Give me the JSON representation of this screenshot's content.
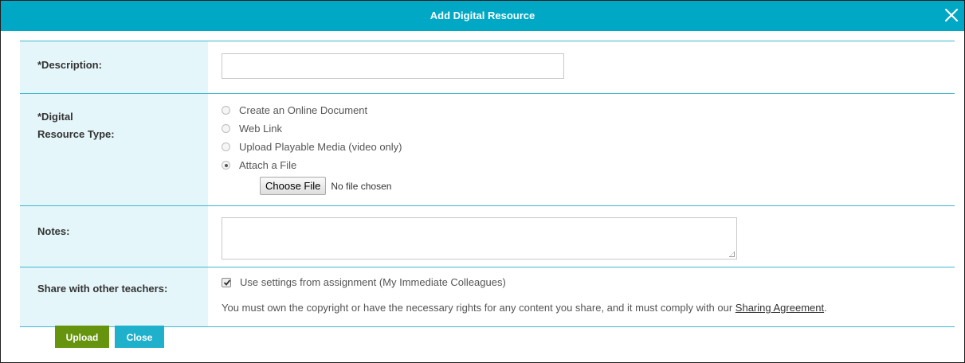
{
  "dialog": {
    "title": "Add Digital Resource",
    "close_icon": "close-x-icon"
  },
  "form": {
    "description": {
      "label": "*Description:",
      "value": "",
      "placeholder": ""
    },
    "resource_type": {
      "label_line1": "*Digital",
      "label_line2": "Resource Type:",
      "options": [
        {
          "label": "Create an Online Document",
          "checked": false
        },
        {
          "label": "Web Link",
          "checked": false
        },
        {
          "label": "Upload Playable Media (video only)",
          "checked": false
        },
        {
          "label": "Attach a File",
          "checked": true
        }
      ],
      "file_button_label": "Choose File",
      "file_status": "No file chosen"
    },
    "notes": {
      "label": "Notes:",
      "value": ""
    },
    "share": {
      "label": "Share with other teachers:",
      "checkbox_label": "Use settings from assignment (My Immediate Colleagues)",
      "checked": true,
      "notice_text": "You must own the copyright or have the necessary rights for any content you share, and it must comply with our ",
      "notice_link": "Sharing Agreement",
      "notice_end": "."
    }
  },
  "actions": {
    "upload_label": "Upload",
    "close_label": "Close"
  },
  "colors": {
    "titlebar": "#00a8c6",
    "label_bg": "#e5f6fa",
    "upload_btn": "#67940f",
    "close_btn": "#1fb1cc"
  }
}
